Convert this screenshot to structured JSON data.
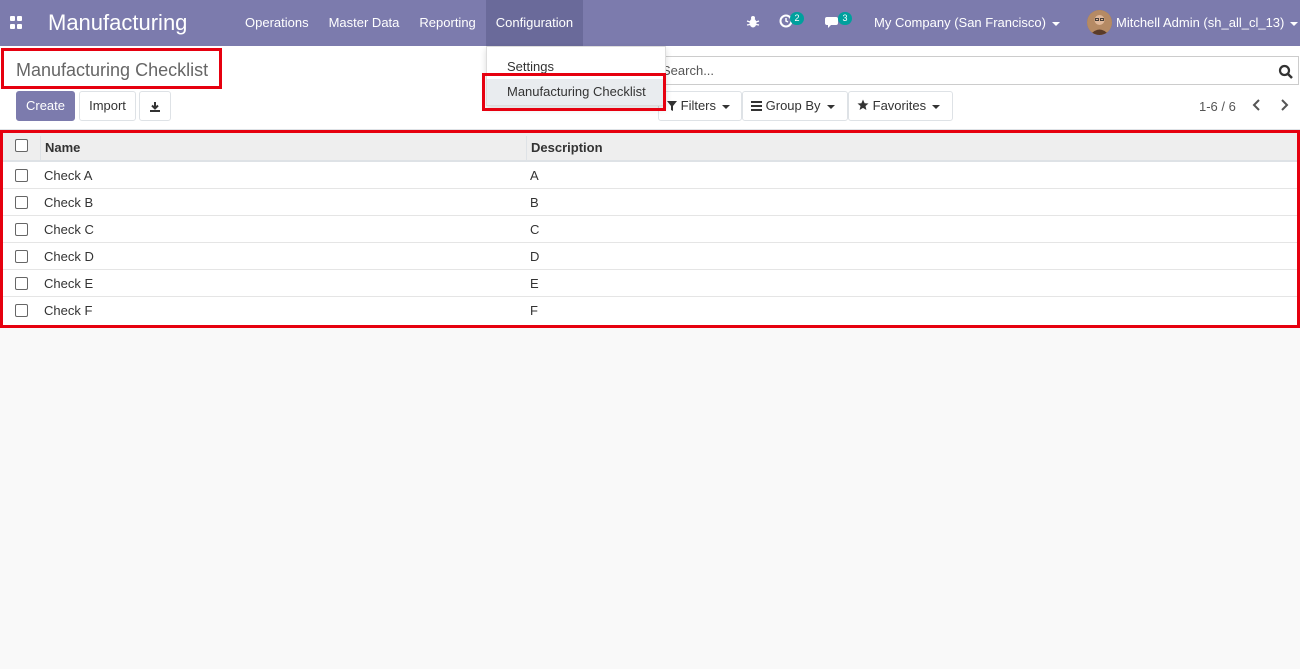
{
  "navbar": {
    "app_name": "Manufacturing",
    "menu": [
      {
        "label": "Operations"
      },
      {
        "label": "Master Data"
      },
      {
        "label": "Reporting"
      },
      {
        "label": "Configuration"
      }
    ],
    "activities_count": "2",
    "messages_count": "3",
    "company": "My Company (San Francisco)",
    "user": "Mitchell Admin (sh_all_cl_13)"
  },
  "dropdown": {
    "items": [
      {
        "label": "Settings"
      },
      {
        "label": "Manufacturing Checklist"
      }
    ]
  },
  "control_panel": {
    "title": "Manufacturing Checklist",
    "create_label": "Create",
    "import_label": "Import",
    "search_placeholder": "Search...",
    "filters_label": "Filters",
    "groupby_label": "Group By",
    "favorites_label": "Favorites",
    "pager": "1-6 / 6"
  },
  "table": {
    "columns": [
      "Name",
      "Description"
    ],
    "rows": [
      {
        "name": "Check A",
        "description": "A"
      },
      {
        "name": "Check B",
        "description": "B"
      },
      {
        "name": "Check C",
        "description": "C"
      },
      {
        "name": "Check D",
        "description": "D"
      },
      {
        "name": "Check E",
        "description": "E"
      },
      {
        "name": "Check F",
        "description": "F"
      }
    ]
  },
  "colors": {
    "primary": "#7c7bad",
    "highlight_box": "#e6000f",
    "badge": "#00a09d"
  }
}
